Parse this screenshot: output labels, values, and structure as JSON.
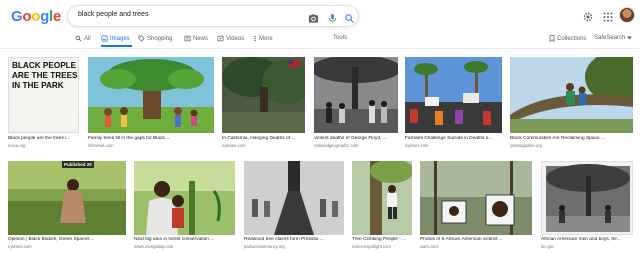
{
  "header": {
    "logo": "Google",
    "logo_colors": [
      "#4285F4",
      "#EA4335",
      "#FBBC05",
      "#4285F4",
      "#34A853",
      "#EA4335"
    ],
    "search_query": "black people and trees",
    "icons": [
      "camera-icon",
      "mic-icon",
      "search-icon",
      "settings-icon",
      "apps-icon",
      "avatar"
    ]
  },
  "tabs": {
    "all": "All",
    "images": "Images",
    "shopping": "Shopping",
    "news": "News",
    "videos": "Videos",
    "more": "More",
    "tools": "Tools",
    "collections": "Collections",
    "safesearch": "SafeSearch"
  },
  "results": {
    "row1": [
      {
        "caption": "Black people are the trees i...",
        "source": "moca.org",
        "sign_text": "BLACK PEOPLE ARE THE TREES IN THE PARK"
      },
      {
        "caption": "Family trees fill in the gaps for Black ...",
        "source": "nbcnews.com"
      },
      {
        "caption": "In California, Hanging Deaths of ...",
        "source": "nytimes.com"
      },
      {
        "caption": "Violent deaths of George Floyd, ...",
        "source": "nationalgeographic.com"
      },
      {
        "caption": "Families Challenge Suicide in Deaths o...",
        "source": "nytimes.com"
      },
      {
        "caption": "Black Communities Are Reclaiming Space ...",
        "source": "yesmagazine.org"
      }
    ],
    "row2": [
      {
        "caption": "Opinion | Black Bodies, Green Spaces ...",
        "source": "nytimes.com",
        "badge": "Published 20"
      },
      {
        "caption": "Next big idea in forest conservation ...",
        "source": "news.mongabay.com"
      },
      {
        "caption": "Redwood tree claims form Presidio ...",
        "source": "parksconservancy.org"
      },
      {
        "caption": "Tree Climbing People - ...",
        "source": "sciencespotlight.com"
      },
      {
        "caption": "Photos of 6 African American victims ...",
        "source": "wam.com"
      },
      {
        "caption": "African American men and boys, thr...",
        "source": "loc.gov"
      }
    ]
  },
  "colors": {
    "accent": "#1a73e8",
    "muted_text": "#70757a",
    "tab_text": "#5f6368"
  }
}
